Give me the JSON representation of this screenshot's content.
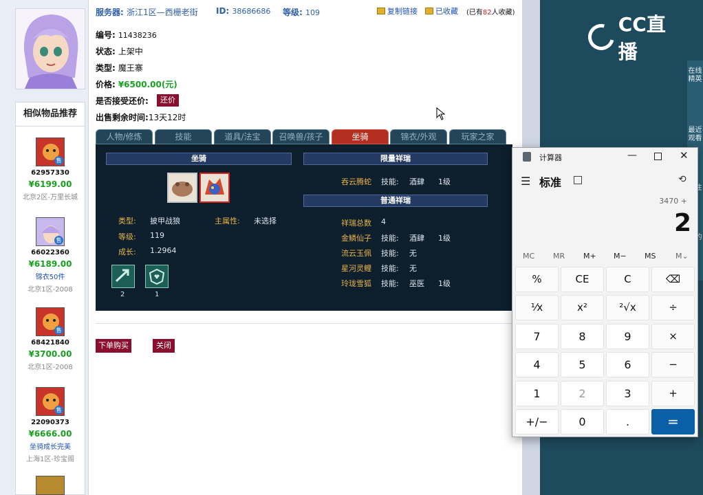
{
  "header": {
    "server_label": "服务器:",
    "server_value": "浙江1区—西栅老街",
    "id_label": "ID:",
    "id_value": "38686686",
    "level_label": "等级:",
    "level_value": "109",
    "copy_link": "复制链接",
    "collected": "已收藏",
    "collect_prefix": "(已有",
    "collect_count": "82",
    "collect_suffix": "人收藏)"
  },
  "info": {
    "number_label": "编号:",
    "number_value": "11438236",
    "status_label": "状态:",
    "status_value": "上架中",
    "type_label": "类型:",
    "type_value": "魔王寨",
    "price_label": "价格:",
    "price_value": "¥6500.00(元)",
    "bargain_label": "是否接受还价:",
    "bargain_button": "还价",
    "remaining_label": "出售剩余时间:",
    "remaining_value": "13天12时"
  },
  "tabs": [
    "人物/修炼",
    "技能",
    "道具/法宝",
    "召唤兽/孩子",
    "坐骑",
    "锦衣/外观",
    "玩家之家"
  ],
  "mount_panel": {
    "mount_header": "坐骑",
    "type_label": "类型:",
    "type_value": "披甲战狼",
    "main_attr_label": "主属性:",
    "main_attr_value": "未选择",
    "level_label": "等级:",
    "level_value": "119",
    "growth_label": "成长:",
    "growth_value": "1.2964",
    "skill_counts": [
      "2",
      "1"
    ],
    "rare_header": "限量祥瑞",
    "rare_items": [
      {
        "name": "吞云腾蛇",
        "skill_label": "技能:",
        "skill": "酒肆",
        "level": "1级"
      }
    ],
    "normal_header": "普通祥瑞",
    "total_label": "祥瑞总数",
    "total_value": "4",
    "normal_items": [
      {
        "name": "金鳞仙子",
        "skill_label": "技能:",
        "skill": "酒肆",
        "level": "1级"
      },
      {
        "name": "流云玉佩",
        "skill_label": "技能:",
        "skill": "无",
        "level": ""
      },
      {
        "name": "星河灵鲤",
        "skill_label": "技能:",
        "skill": "无",
        "level": ""
      },
      {
        "name": "玲珑雪狐",
        "skill_label": "技能:",
        "skill": "巫医",
        "level": "1级"
      }
    ]
  },
  "actions": {
    "buy": "下单购买",
    "close": "关闭"
  },
  "recommend": {
    "title": "相似物品推荐",
    "sold_tag": "售",
    "items": [
      {
        "id": "62957330",
        "price": "¥6199.00",
        "note": "",
        "server": "北京2区-万里长城"
      },
      {
        "id": "66022360",
        "price": "¥6189.00",
        "note": "锦衣50件",
        "server": "北京1区-2008"
      },
      {
        "id": "68421840",
        "price": "¥3700.00",
        "note": "",
        "server": "北京1区-2008"
      },
      {
        "id": "22090373",
        "price": "¥6666.00",
        "note": "坐骑成长完美",
        "server": "上海1区-珍宝阁"
      }
    ]
  },
  "cc": {
    "logo": "CC直播",
    "side_1": "在线精英",
    "side_2": "最近观看",
    "side_3": "关注",
    "side_4": "我的"
  },
  "calculator": {
    "app_title": "计算器",
    "mode": "标准",
    "expression": "3470 +",
    "display": "2",
    "memory": [
      "MC",
      "MR",
      "M+",
      "M−",
      "MS",
      "M⌄"
    ],
    "keys": [
      [
        "%",
        "CE",
        "C",
        "⌫"
      ],
      [
        "⅟x",
        "x²",
        "²√x",
        "÷"
      ],
      [
        "7",
        "8",
        "9",
        "×"
      ],
      [
        "4",
        "5",
        "6",
        "−"
      ],
      [
        "1",
        "2",
        "3",
        "+"
      ],
      [
        "+/−",
        "0",
        ".",
        "="
      ]
    ]
  },
  "colors": {
    "accent_red": "#8a0f2e",
    "price_green": "#1aa020",
    "link_blue": "#1f4fb8",
    "calc_equals": "#0a5fa6",
    "cc_bg": "#1e4a5d"
  }
}
